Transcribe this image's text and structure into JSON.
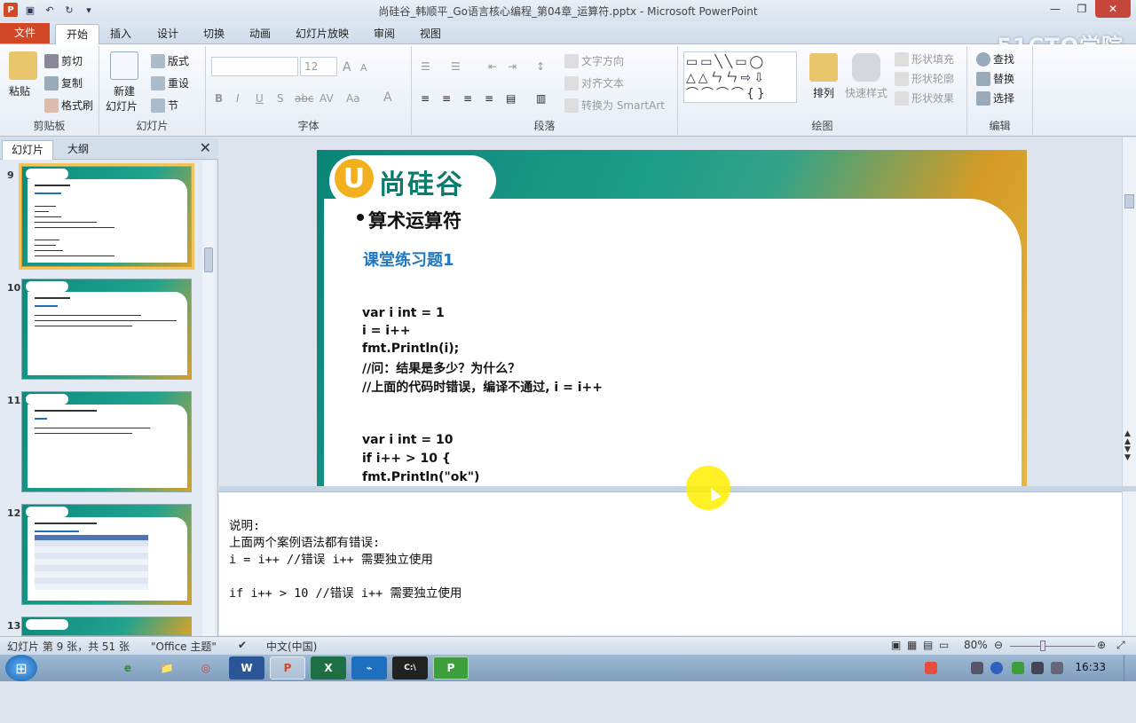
{
  "window": {
    "title": "尚硅谷_韩顺平_Go语言核心编程_第04章_运算符.pptx - Microsoft PowerPoint",
    "app_letter": "P"
  },
  "ribbon_tabs": [
    "文件",
    "开始",
    "插入",
    "设计",
    "切换",
    "动画",
    "幻灯片放映",
    "审阅",
    "视图"
  ],
  "watermark": "51CTO学院",
  "ribbon": {
    "clipboard": {
      "paste": "粘贴",
      "cut": "剪切",
      "copy": "复制",
      "format_painter": "格式刷",
      "label": "剪贴板"
    },
    "slides": {
      "new_slide_1": "新建",
      "new_slide_2": "幻灯片",
      "layout": "版式",
      "reset": "重设",
      "section": "节",
      "label": "幻灯片"
    },
    "font": {
      "size": "12",
      "bold": "B",
      "italic": "I",
      "underline": "U",
      "shadow": "S",
      "strike": "abc",
      "spacing": "AV",
      "case": "Aa",
      "grow": "A",
      "shrink": "A",
      "color": "A",
      "label": "字体"
    },
    "paragraph": {
      "text_direction": "文字方向",
      "align_text": "对齐文本",
      "smartart": "转换为 SmartArt",
      "label": "段落"
    },
    "drawing": {
      "arrange": "排列",
      "quick_styles": "快速样式",
      "shape_fill": "形状填充",
      "shape_outline": "形状轮廓",
      "shape_effects": "形状效果",
      "label": "绘图"
    },
    "editing": {
      "find": "查找",
      "replace": "替换",
      "select": "选择",
      "label": "编辑"
    }
  },
  "panel": {
    "tab_slides": "幻灯片",
    "tab_outline": "大纲",
    "close": "✕",
    "thumbnails": [
      {
        "number": "9",
        "selected": true
      },
      {
        "number": "10",
        "selected": false
      },
      {
        "number": "11",
        "selected": false
      },
      {
        "number": "12",
        "selected": false
      },
      {
        "number": "13",
        "selected": false
      }
    ]
  },
  "slide": {
    "logo_mark": "U",
    "logo_text": "尚硅谷",
    "heading": "算术运算符",
    "subheading": "课堂练习题1",
    "code": [
      "var i int = 1",
      "i = i++",
      "fmt.Println(i);",
      "//问：结果是多少？为什么？",
      "//上面的代码时错误，编译不通过, i = i++",
      "var i int = 10",
      "if i++ > 10 {",
      "fmt.Println(\"ok\")"
    ]
  },
  "notes": [
    "说明:",
    "上面两个案例语法都有错误:",
    "i = i++ //错误 i++ 需要独立使用",
    "",
    "if i++ > 10 //错误 i++ 需要独立使用"
  ],
  "status": {
    "slide_info": "幻灯片 第 9 张，共 51 张",
    "theme": "\"Office 主题\"",
    "language": "中文(中国)",
    "zoom": "80%"
  },
  "taskbar": {
    "clock": "16:33",
    "apps": [
      "e",
      "📁",
      "◎",
      "W",
      "P",
      "X",
      "⌁",
      "C:\\",
      "P"
    ]
  }
}
